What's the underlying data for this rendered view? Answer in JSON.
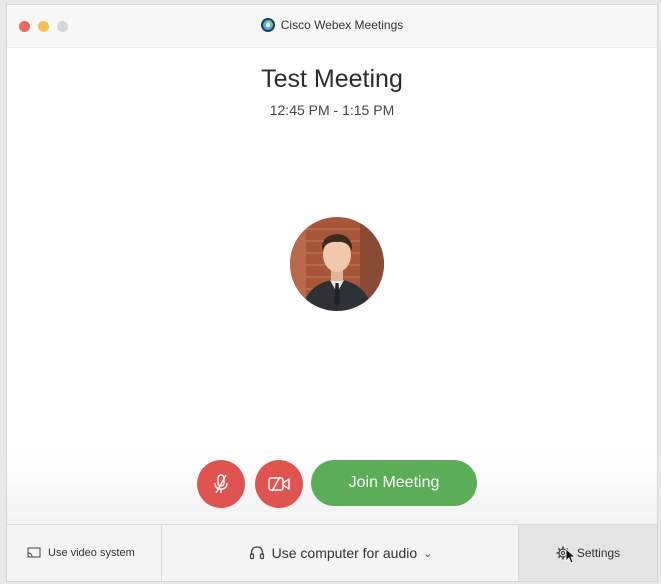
{
  "window": {
    "title": "Cisco Webex Meetings"
  },
  "meeting": {
    "title": "Test Meeting",
    "time": "12:45 PM - 1:15 PM"
  },
  "controls": {
    "join_label": "Join Meeting"
  },
  "bottombar": {
    "video_system_label": "Use video system",
    "audio_label": "Use computer for audio",
    "audio_chevron": "⌄",
    "settings_label": "Settings"
  },
  "colors": {
    "close": "#ee6a5f",
    "minimize": "#f5bf4f",
    "maximize": "#d6d6d6",
    "mute_button": "#e0544f",
    "join_button": "#5cad58"
  },
  "icons": {
    "app_logo": "webex-logo",
    "mute": "microphone-muted-icon",
    "video": "video-off-icon",
    "video_system": "screen-cast-icon",
    "audio": "headset-icon",
    "settings": "gear-icon"
  }
}
